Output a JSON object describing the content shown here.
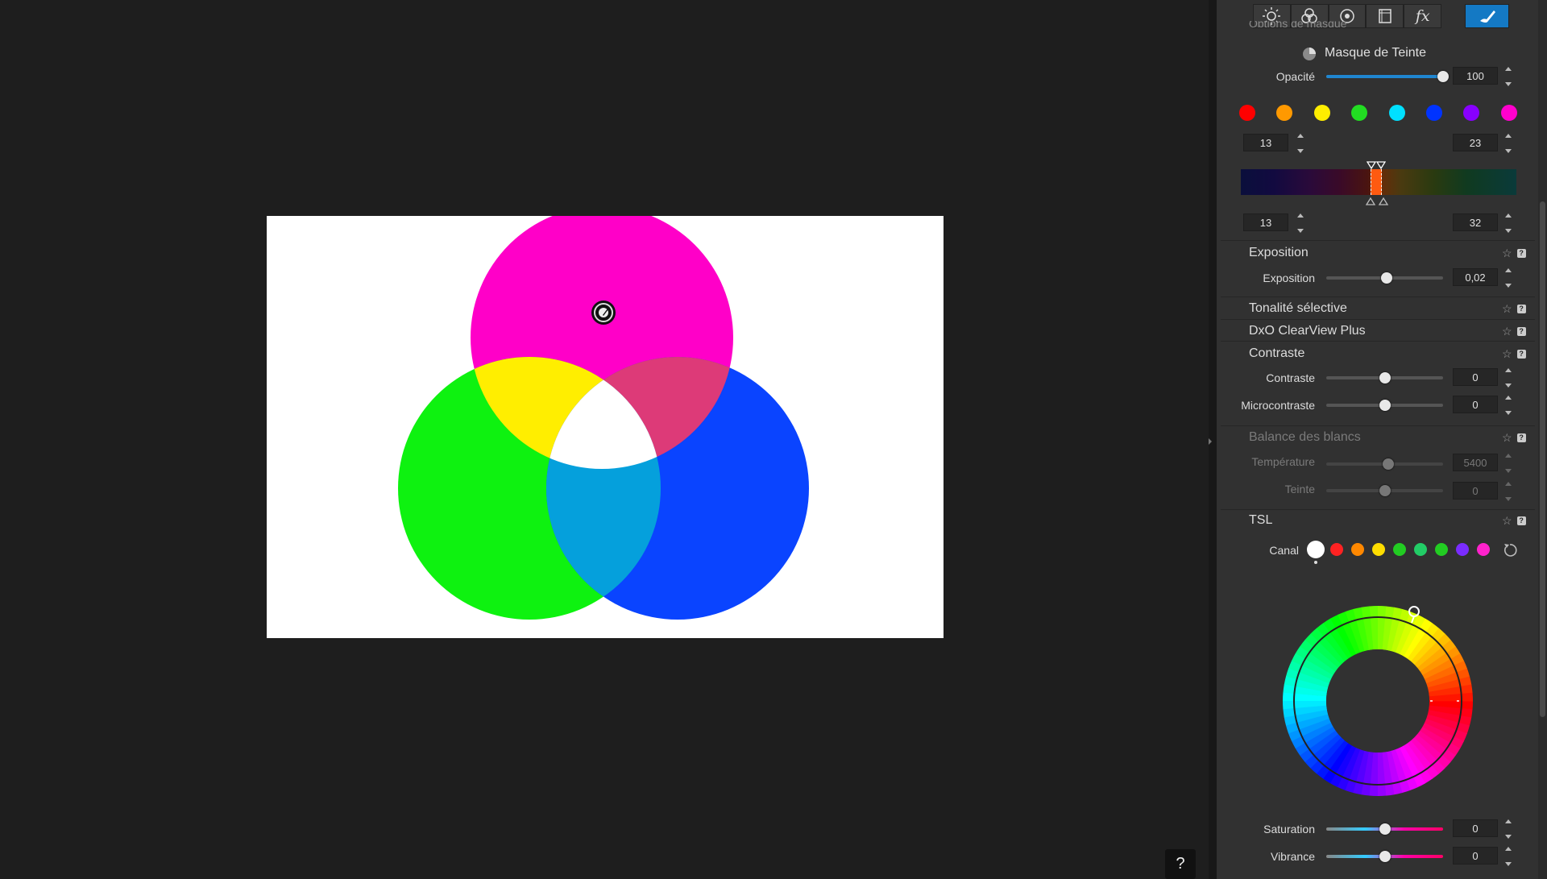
{
  "toolbar": {
    "icons": [
      "light-icon",
      "color-icon",
      "detail-icon",
      "geometry-icon",
      "effects-icon",
      "local-adjust-icon"
    ],
    "effects_label": "fx",
    "active": "local-adjust-icon",
    "active_color": "#1479c4"
  },
  "mask_panel": {
    "partial_title": "Options de masque",
    "mask_title": "Masque de Teinte",
    "opacity_label": "Opacité",
    "opacity_value": "100",
    "opacity": 100,
    "swatches": [
      "#ff0000",
      "#ff9900",
      "#ffee00",
      "#22dd22",
      "#00e0ff",
      "#0033ff",
      "#8800ff",
      "#ff00cc"
    ],
    "range_top_left": "13",
    "range_top_right": "23",
    "range_bottom_left": "13",
    "range_bottom_right": "32"
  },
  "exposition": {
    "header": "Exposition",
    "label": "Exposition",
    "value": "0,02"
  },
  "tonalite": {
    "header": "Tonalité sélective"
  },
  "clearview": {
    "header": "DxO ClearView Plus"
  },
  "contraste": {
    "header": "Contraste",
    "contraste_label": "Contraste",
    "contraste_value": "0",
    "micro_label": "Microcontraste",
    "micro_value": "0"
  },
  "balance": {
    "header": "Balance des blancs",
    "temp_label": "Température",
    "temp_value": "5400",
    "teinte_label": "Teinte",
    "teinte_value": "0"
  },
  "tsl": {
    "header": "TSL",
    "canal_label": "Canal",
    "canal_colors": [
      "#ffffff",
      "#ff2222",
      "#ff8800",
      "#ffdd00",
      "#22cc22",
      "#22cc66",
      "#22cc22",
      "#7a2cff",
      "#ff22cc"
    ],
    "saturation_label": "Saturation",
    "saturation_value": "0",
    "vibrance_label": "Vibrance",
    "vibrance_value": "0"
  },
  "viewer": {
    "help_label": "?"
  }
}
